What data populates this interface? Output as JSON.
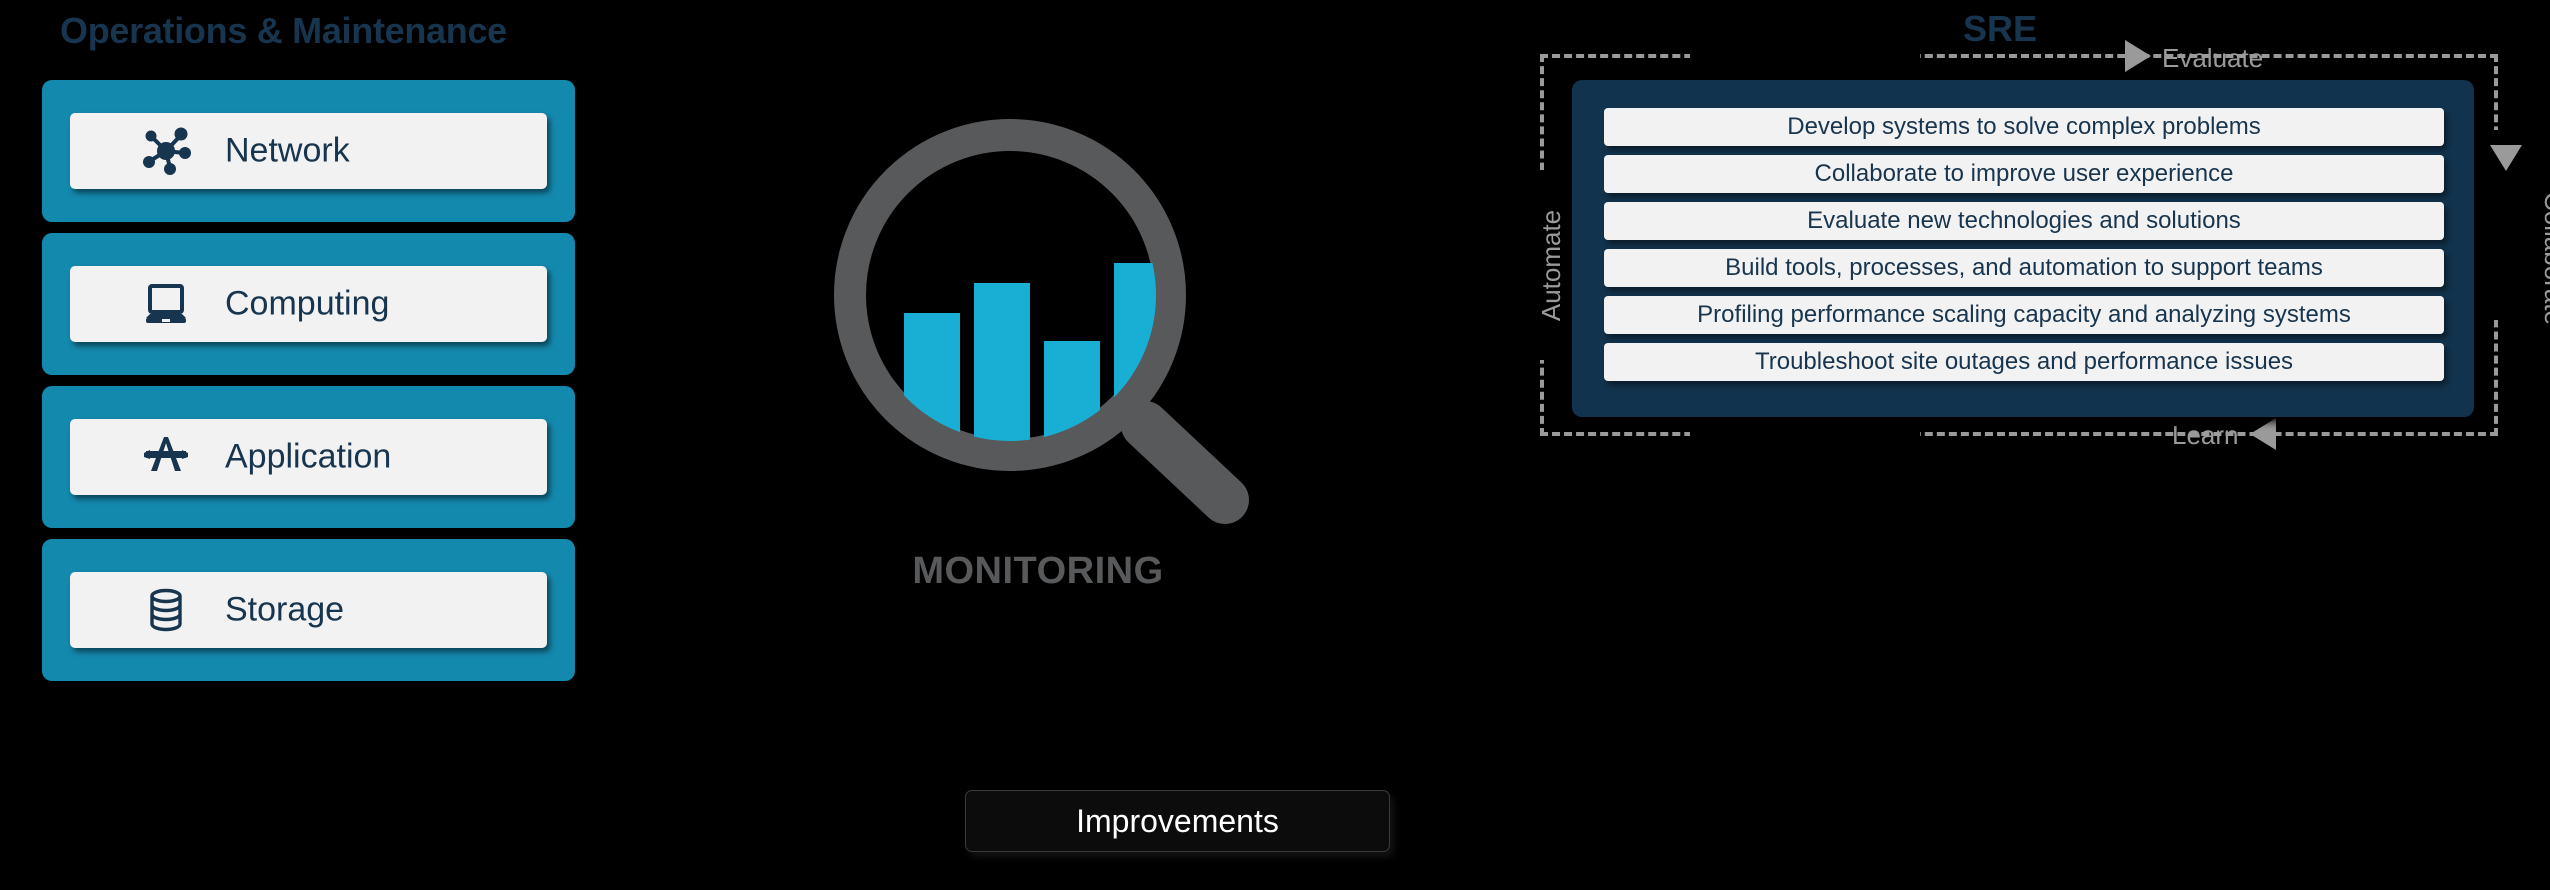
{
  "operations": {
    "title": "Operations & Maintenance",
    "cards": [
      {
        "label": "Network",
        "icon": "network-nodes-icon"
      },
      {
        "label": "Computing",
        "icon": "laptop-icon"
      },
      {
        "label": "Application",
        "icon": "app-store-icon"
      },
      {
        "label": "Storage",
        "icon": "database-cylinder-icon"
      }
    ]
  },
  "monitoring": {
    "label": "MONITORING",
    "icon": "magnifying-glass-bar-chart-icon",
    "bar_color": "#19AFD5",
    "glass_color": "#58595b"
  },
  "sre": {
    "title": "SRE",
    "panel_color": "#12334d",
    "cycle": {
      "top": "Evaluate",
      "right": "Collaborate",
      "bottom": "Learn",
      "left": "Automate"
    },
    "items": [
      "Develop systems to solve complex problems",
      "Collaborate to improve user experience",
      "Evaluate new technologies and solutions",
      "Build tools, processes, and automation to support teams",
      "Profiling performance scaling capacity and analyzing systems",
      "Troubleshoot site outages and performance issues"
    ]
  },
  "improvements": {
    "label": "Improvements"
  },
  "colors": {
    "teal": "#1489ae",
    "navy": "#17354e",
    "panel": "#12334d",
    "card_face": "#f2f2f2",
    "dash_gray": "#9a9a9a",
    "background": "#000000"
  }
}
